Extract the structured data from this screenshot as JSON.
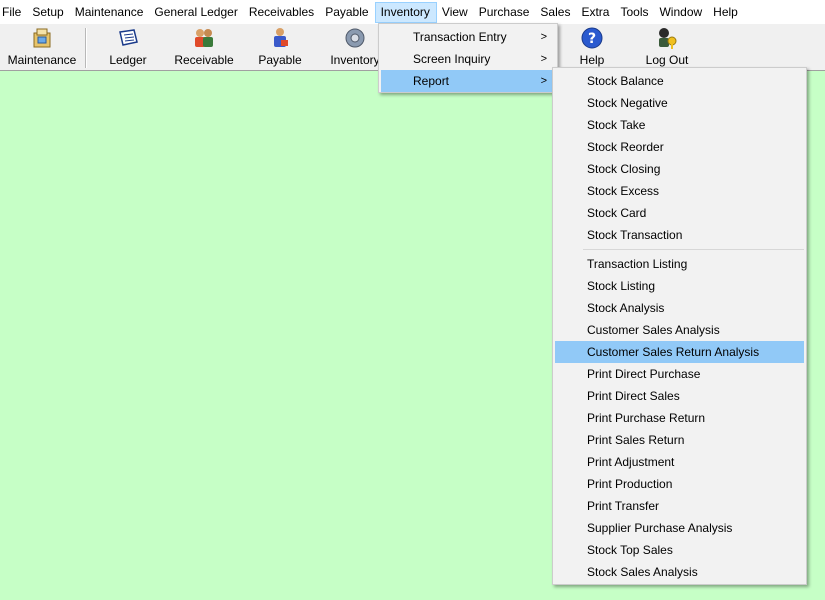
{
  "menubar": [
    "File",
    "Setup",
    "Maintenance",
    "General Ledger",
    "Receivables",
    "Payable",
    "Inventory",
    "View",
    "Purchase",
    "Sales",
    "Extra",
    "Tools",
    "Window",
    "Help"
  ],
  "active_menu": "Inventory",
  "toolbar": {
    "maintenance": "Maintenance",
    "ledger": "Ledger",
    "receivable": "Receivable",
    "payable": "Payable",
    "inventory": "Inventory",
    "help": "Help",
    "logout": "Log Out"
  },
  "inventory_menu": {
    "items": [
      {
        "label": "Transaction Entry",
        "submenu": true
      },
      {
        "label": "Screen Inquiry",
        "submenu": true
      },
      {
        "label": "Report",
        "submenu": true,
        "highlighted": true
      }
    ],
    "arrow": ">"
  },
  "report_menu": {
    "group1": [
      "Stock Balance",
      "Stock Negative",
      "Stock Take",
      "Stock Reorder",
      "Stock Closing",
      "Stock Excess",
      "Stock Card",
      "Stock Transaction"
    ],
    "group2": [
      "Transaction Listing",
      "Stock Listing",
      "Stock Analysis",
      "Customer Sales Analysis",
      "Customer Sales Return Analysis",
      "Print Direct Purchase",
      "Print Direct Sales",
      "Print Purchase Return",
      "Print Sales Return",
      "Print Adjustment",
      "Print Production",
      "Print Transfer",
      "Supplier Purchase Analysis",
      "Stock Top Sales",
      "Stock Sales Analysis"
    ],
    "highlighted": "Customer Sales Return Analysis"
  },
  "colors": {
    "background": "#c6ffc6",
    "highlight": "#91c9f7",
    "menu_active": "#cce8ff"
  }
}
